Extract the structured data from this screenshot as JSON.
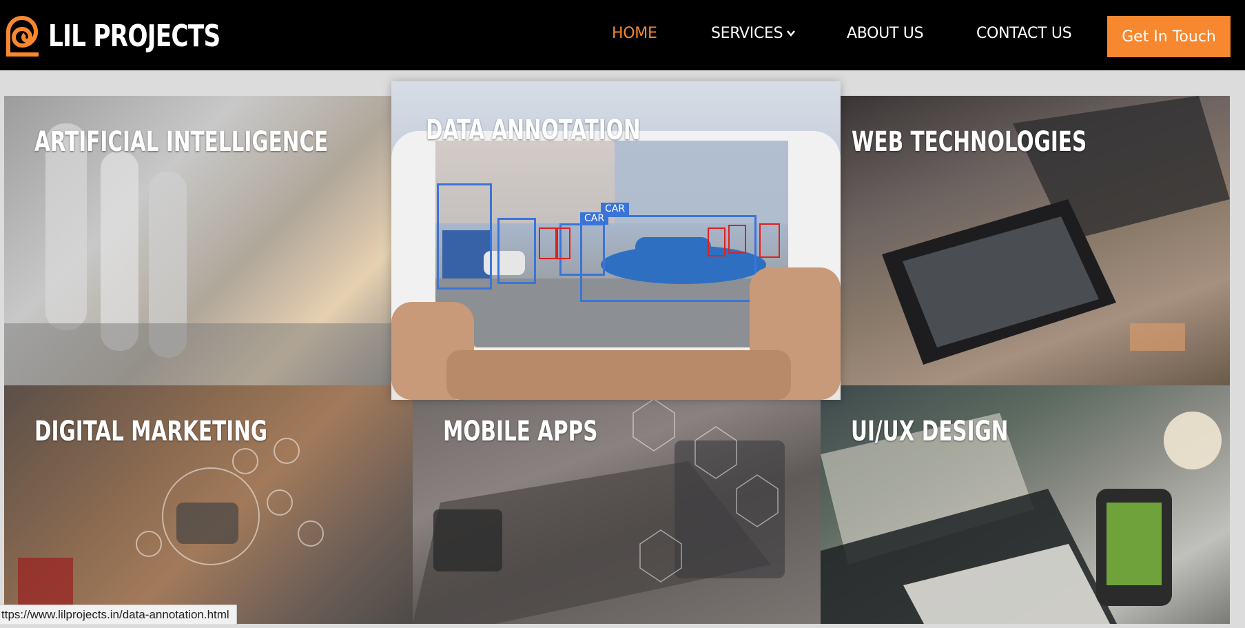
{
  "brand": {
    "name": "LIL PROJECTS",
    "accent": "#f7882f"
  },
  "nav": {
    "items": [
      {
        "label": "HOME",
        "active": true
      },
      {
        "label": "SERVICES",
        "active": false,
        "icon": "chevron-down-icon"
      },
      {
        "label": "ABOUT US",
        "active": false
      },
      {
        "label": "CONTACT US",
        "active": false
      }
    ],
    "cta": "Get In Touch"
  },
  "services": {
    "ai": "ARTIFICIAL INTELLIGENCE",
    "data_annotation": "DATA ANNOTATION",
    "web": "WEB TECHNOLOGIES",
    "digital_marketing": "DIGITAL MARKETING",
    "mobile": "MOBILE APPS",
    "uiux": "UI/UX DESIGN"
  },
  "annotation_labels": {
    "car": "CAR"
  },
  "status_bar": {
    "url": "ttps://www.lilprojects.in/data-annotation.html"
  }
}
